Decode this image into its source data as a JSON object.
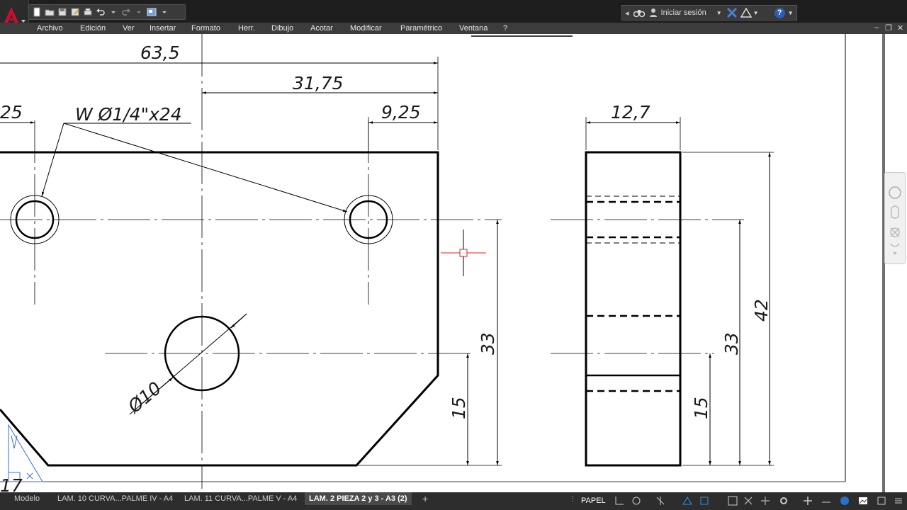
{
  "app": {
    "logo_letter": "A",
    "accent": "#c8102e"
  },
  "quick_access": {
    "icons": [
      "new-icon",
      "open-icon",
      "save-icon",
      "saveas-icon",
      "plot-icon",
      "undo-icon",
      "redo-icon",
      "workspace-icon"
    ]
  },
  "signin": {
    "label": "Iniciar sesión",
    "help": "?"
  },
  "menu": {
    "items": [
      "Archivo",
      "Edición",
      "Ver",
      "Insertar",
      "Formato",
      "Herr.",
      "Dibujo",
      "Acotar",
      "Modificar",
      "Paramétrico",
      "Ventana",
      "?"
    ]
  },
  "drawing": {
    "dims": {
      "d63_5": "63,5",
      "d31_75": "31,75",
      "d25": "25",
      "d9_25": "9,25",
      "hole_note": "W Ø1/4\"x24",
      "d12_7": "12,7",
      "d33": "33",
      "d15": "15",
      "d42": "42",
      "phi10": "Ø10",
      "d17": "17"
    }
  },
  "status": {
    "tabs": [
      "Modelo",
      "LAM. 10 CURVA...PALME IV - A4",
      "LAM. 11 CURVA...PALME V - A4",
      "LAM. 2 PIEZA 2 y 3 - A3 (2)"
    ],
    "add_tab": "+",
    "space": "PAPEL"
  }
}
